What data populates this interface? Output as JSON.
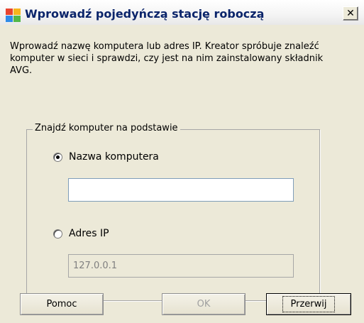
{
  "window": {
    "title": "Wprowadź pojedyńczą stację roboczą",
    "close_glyph": "✕"
  },
  "description": "Wprowadź nazwę komputera lub adres IP. Kreator spróbuje znaleźć komputer w sieci i sprawdzi, czy jest na nim zainstalowany składnik AVG.",
  "group": {
    "legend": "Znajdź komputer na podstawie",
    "options": [
      {
        "label": "Nazwa komputera",
        "selected": true,
        "value": ""
      },
      {
        "label": "Adres IP",
        "selected": false,
        "value": "127.0.0.1",
        "disabled": true
      }
    ]
  },
  "buttons": {
    "help": "Pomoc",
    "ok": "OK",
    "cancel": "Przerwij"
  },
  "icons": {
    "app": "avg-app-icon",
    "close": "close-icon"
  }
}
